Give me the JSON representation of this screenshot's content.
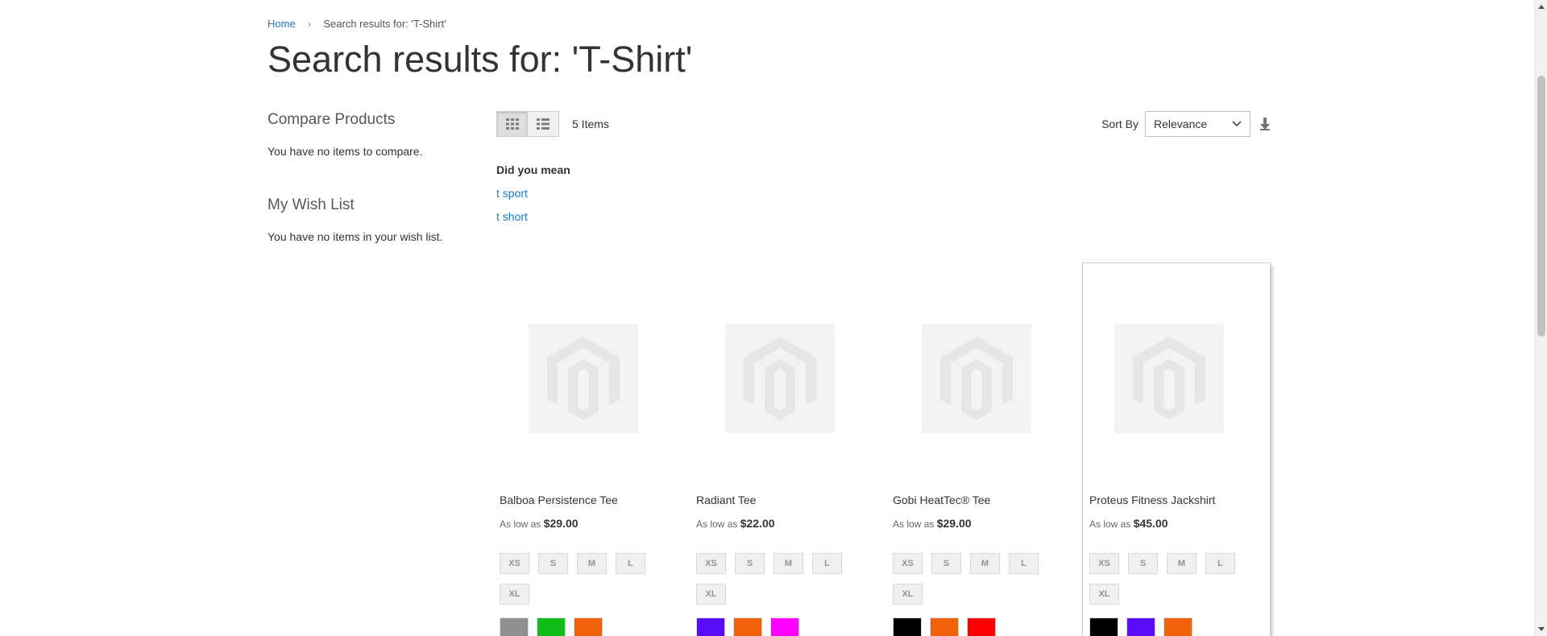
{
  "breadcrumb": {
    "home": "Home",
    "separator": "›",
    "current": "Search results for: 'T-Shirt'"
  },
  "page_title": "Search results for: 'T-Shirt'",
  "sidebar": {
    "compare_title": "Compare Products",
    "compare_text": "You have no items to compare.",
    "wishlist_title": "My Wish List",
    "wishlist_text": "You have no items in your wish list."
  },
  "toolbar": {
    "grid_mode_icon": "grid-icon",
    "list_mode_icon": "list-icon",
    "items_count": "5 Items",
    "sort_label": "Sort By",
    "sort_value": "Relevance",
    "sort_direction_icon": "sort-arrow-down-icon"
  },
  "did_you_mean": {
    "title": "Did you mean",
    "suggestions": [
      "t sport",
      "t short"
    ]
  },
  "products": [
    {
      "name": "Balboa Persistence Tee",
      "price_prefix": "As low as",
      "price": "$29.00",
      "sizes": [
        "XS",
        "S",
        "M",
        "L",
        "XL"
      ],
      "colors": [
        "#8f8f8f",
        "#0fbe16",
        "#f0620a"
      ]
    },
    {
      "name": "Radiant Tee",
      "price_prefix": "As low as",
      "price": "$22.00",
      "sizes": [
        "XS",
        "S",
        "M",
        "L",
        "XL"
      ],
      "colors": [
        "#5b0bfb",
        "#f0620a",
        "#ff00ff"
      ]
    },
    {
      "name": "Gobi HeatTec® Tee",
      "price_prefix": "As low as",
      "price": "$29.00",
      "sizes": [
        "XS",
        "S",
        "M",
        "L",
        "XL"
      ],
      "colors": [
        "#000000",
        "#f0620a",
        "#ff0000"
      ]
    },
    {
      "name": "Proteus Fitness Jackshirt",
      "price_prefix": "As low as",
      "price": "$45.00",
      "sizes": [
        "XS",
        "S",
        "M",
        "L",
        "XL"
      ],
      "colors": [
        "#000000",
        "#5b0bfb",
        "#f0620a"
      ]
    }
  ],
  "colors": {
    "link": "#1979c3",
    "placeholder_bg": "#f3f3f3"
  }
}
